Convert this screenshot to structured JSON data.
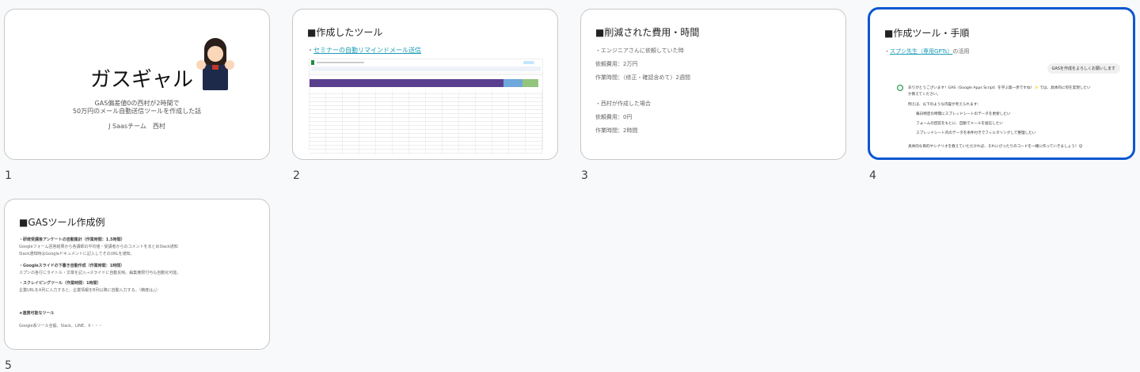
{
  "slides": [
    {
      "number": "1",
      "title": "ガスギャル",
      "subtitle_line1": "GAS偏差値0の西村が2時間で",
      "subtitle_line2": "50万円のメール自動送信ツールを作成した話",
      "author": "J Saasチーム　西村"
    },
    {
      "number": "2",
      "title": "■作成したツール",
      "link_prefix": "・",
      "link": "セミナーの自動リマインドメール送信"
    },
    {
      "number": "3",
      "title": "■削減された費用・時間",
      "lines": [
        "・エンジニアさんに依頼していた時",
        "依頼費用：2万円",
        "作業時間：（修正・確認含めて）2週間",
        "・西村が作成した場合",
        "依頼費用：0円",
        "作業時間：2時間"
      ]
    },
    {
      "number": "4",
      "title": "■作成ツール・手順",
      "link_prefix": "・",
      "link": "スプシ先生（専用GPTs）",
      "link_suffix": "の活用",
      "user_msg": "GASを作成をよろしくお願いします",
      "ai_lines": [
        "ありがとうございます！GAS（Google Apps Script）を学ぶ第一歩ですね！✨ では、具体的に何を実現したい",
        "か教えてください。",
        "例えば、以下のような内容が考えられます：",
        "毎日特定の時間にスプレッドシートのデータを更新したい",
        "フォームの回答をもとに、自動でメールを送信したい",
        "スプレッドシート内のデータを条件付きでフィルタリングして整理したい",
        "具体的な目的やシナリオを教えていただければ、それにぴったりのコードを一緒に作っていきましょう！😊"
      ]
    },
    {
      "number": "5",
      "title": "■GASツール作成例",
      "lines": [
        "・研修受講後アンケートの自動集計（作業時間：1.5時間）",
        "Googleフォーム回答結果から各講師の平均値・受講者からのコメントをまとめSlack通知",
        "Slack通知時はGoogleドキュメントに記入してそのURLを通知。",
        "・Googleスライドの下書き自動作成（作業時間：1時間）",
        "スプシの各行にタイトル・文章を記入→スライドに自動反映。編集権限付与も自動化可能。",
        "・スクレイピングツール（作業時間：1時間）",
        "企業URLをA列に入力すると、企業情報をB列以降に自動入力する。（精度は△）",
        "★連携可能なツール",
        "Google系ツール全般、Slack、LINE、X・・・"
      ]
    }
  ],
  "colors": {
    "selected": "#0b57d0",
    "link": "#1a9bb5",
    "sheet_header": "#5b3f8f"
  }
}
